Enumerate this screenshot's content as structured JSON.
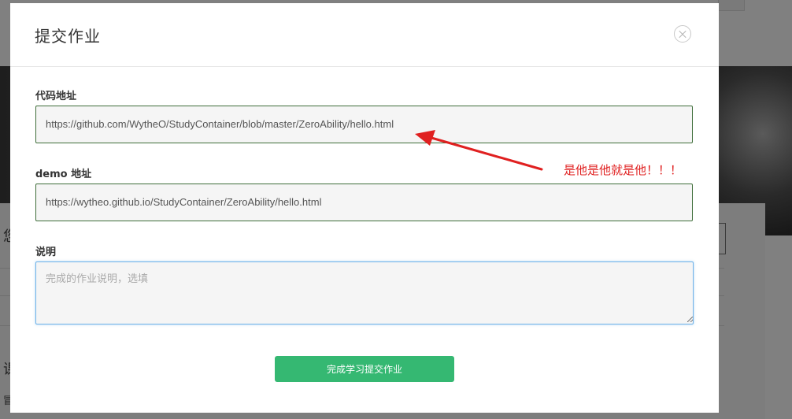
{
  "background": {
    "side_chars": [
      "您",
      "课",
      "冒"
    ]
  },
  "modal": {
    "title": "提交作业",
    "fields": [
      {
        "label": "代码地址",
        "value": "https://github.com/WytheO/StudyContainer/blob/master/ZeroAbility/hello.html"
      },
      {
        "label": "demo 地址",
        "value": "https://wytheo.github.io/StudyContainer/ZeroAbility/hello.html"
      },
      {
        "label": "说明",
        "value": "",
        "placeholder": "完成的作业说明，选填"
      }
    ],
    "submit_label": "完成学习提交作业"
  },
  "annotation": {
    "text": "是他是他就是他！！！",
    "color": "#e02020"
  },
  "colors": {
    "primary_button": "#35b872",
    "input_border": "#3f6e3a",
    "focus_border": "#6fb2e8",
    "overlay": "#808080"
  }
}
